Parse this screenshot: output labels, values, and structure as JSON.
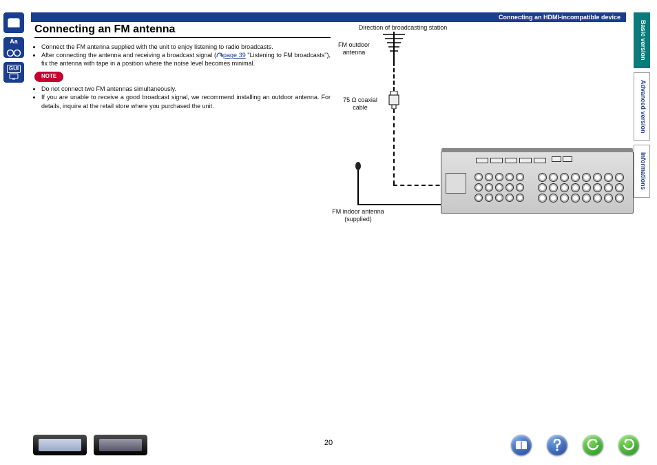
{
  "topbar": {
    "breadcrumb": "Connecting an HDMI-incompatible device"
  },
  "section": {
    "title": "Connecting an FM antenna"
  },
  "body": {
    "b1": "Connect the FM antenna supplied with the unit to enjoy listening to radio broadcasts.",
    "b2a": "After connecting the antenna and receiving a broadcast signal (",
    "b2_link": "page 39",
    "b2b": " \"Listening to FM broadcasts\"), fix the antenna with tape in a position where the noise level becomes minimal.",
    "note_label": "NOTE",
    "n1": "Do not connect two FM antennas simultaneously.",
    "n2": "If you are unable to receive a good broadcast signal, we recommend installing an outdoor antenna. For details, inquire at the retail store where you purchased the unit."
  },
  "diagram": {
    "direction": "Direction of broadcasting station",
    "outdoor": "FM outdoor\nantenna",
    "coax": "75 Ω coaxial\ncable",
    "indoor": "FM indoor antenna\n(supplied)"
  },
  "tabs": {
    "basic": "Basic version",
    "advanced": "Advanced version",
    "info": "Informations"
  },
  "sidebar": {
    "aa": "Aa",
    "gui": "GUI"
  },
  "page_number": "20"
}
